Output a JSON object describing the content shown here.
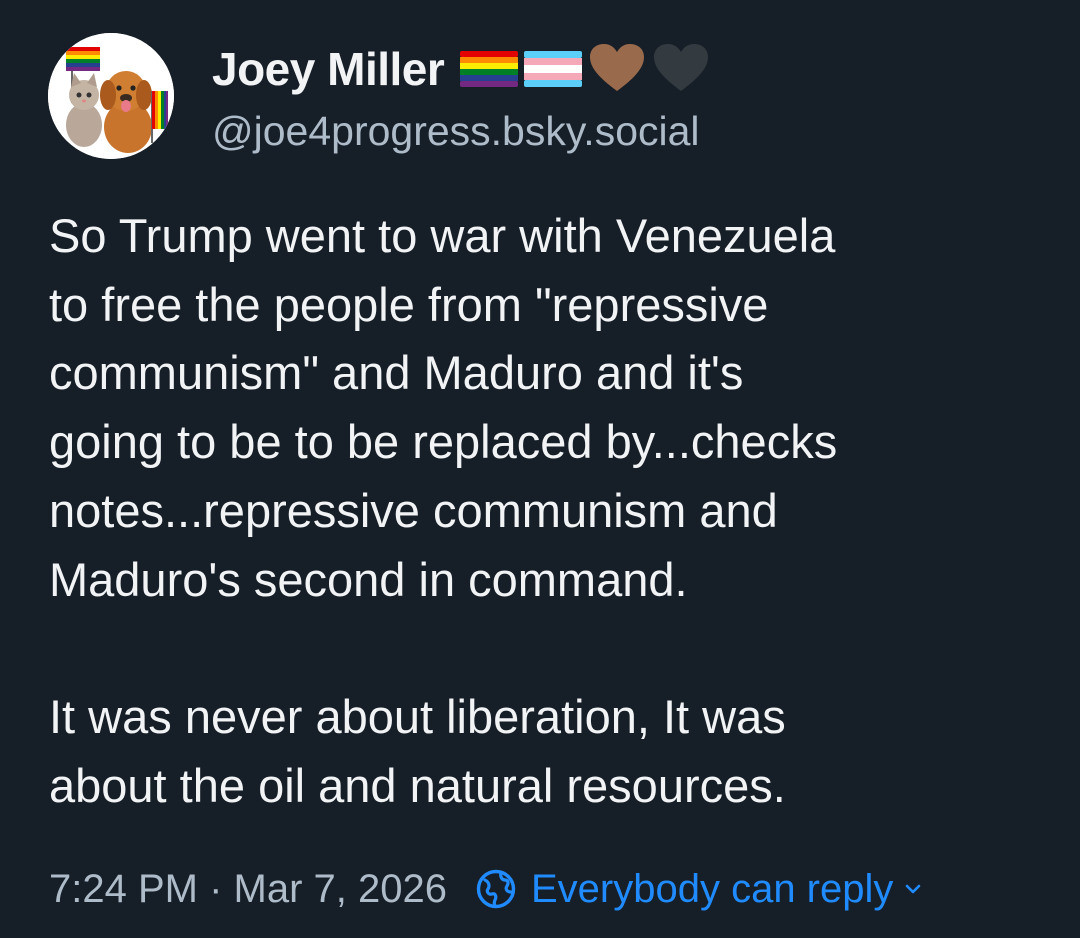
{
  "post": {
    "author": {
      "display_name": "Joey Miller",
      "handle": "@joe4progress.bsky.social",
      "flair_icons": [
        "rainbow-pride-flag",
        "transgender-flag",
        "brown-heart",
        "black-heart"
      ],
      "avatar_description": "cartoon kitten and puppy holding pride flags"
    },
    "text": {
      "lines_p1": [
        "So Trump went to war with Venezuela",
        "to free the people from \"repressive",
        "communism\" and Maduro and it's",
        "going to be to be replaced by...checks",
        "notes...repressive communism and",
        "Maduro's second in command."
      ],
      "lines_p2": [
        "It was never about liberation, It was",
        "about the oil and natural resources."
      ]
    },
    "timestamp": "7:24 PM · Mar 7, 2026",
    "reply_setting": {
      "label": "Everybody can reply",
      "icon": "globe-icon",
      "chevron": "chevron-down-icon"
    }
  },
  "colors": {
    "background": "#161e27",
    "text": "#f1f3f5",
    "muted": "#aebbc9",
    "accent": "#208bfe"
  }
}
